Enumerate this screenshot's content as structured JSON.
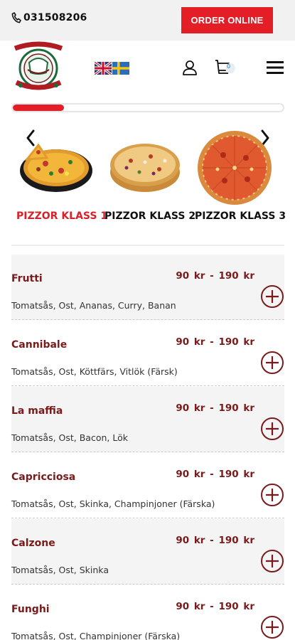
{
  "topbar": {
    "phone": "031508206",
    "order_label": "ORDER ONLINE"
  },
  "header": {
    "logo_icon": "brunnsbo-pizzeria-logo",
    "languages": [
      "english-flag-icon",
      "swedish-flag-icon"
    ],
    "cart_count": "0"
  },
  "progress": {
    "value": 0.19
  },
  "categories": [
    {
      "label": "PIZZOR KLASS 1",
      "active": true
    },
    {
      "label": "PIZZOR KLASS 2",
      "active": false
    },
    {
      "label": "PIZZOR KLASS 3",
      "active": false
    }
  ],
  "items": [
    {
      "name": "Frutti",
      "price": "90 kr  - 190 kr",
      "desc": "Tomatsås, Ost, Ananas, Curry, Banan"
    },
    {
      "name": "Cannibale",
      "price": "90 kr  - 190 kr",
      "desc": "Tomatsås, Ost, Köttfärs, Vitlök (Färsk)"
    },
    {
      "name": "La maffia",
      "price": "90 kr  - 190 kr",
      "desc": "Tomatsås, Ost, Bacon, Lök"
    },
    {
      "name": "Capricciosa",
      "price": "90 kr  - 190 kr",
      "desc": "Tomatsås, Ost, Skinka, Champinjoner (Färska)"
    },
    {
      "name": "Calzone",
      "price": "90 kr  - 190 kr",
      "desc": "Tomatsås, Ost, Skinka"
    },
    {
      "name": "Funghi",
      "price": "90 kr  - 190 kr",
      "desc": "Tomatsås, Ost, Champinjoner (Färska)"
    }
  ],
  "colors": {
    "accent": "#e41e26",
    "price": "#7a1a1a"
  }
}
